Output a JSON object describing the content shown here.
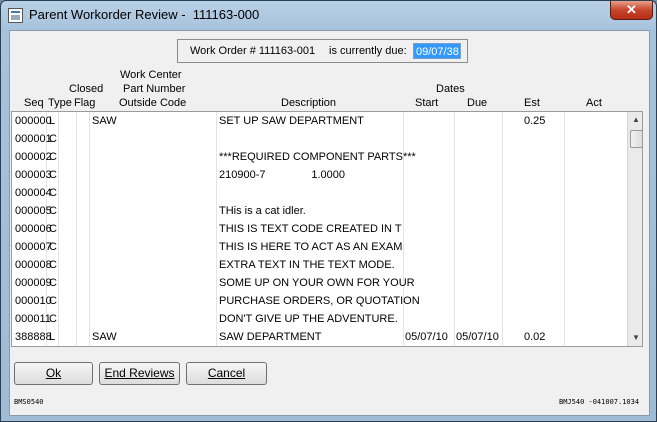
{
  "window": {
    "title": "Parent Workorder Review -  111163-000"
  },
  "workorder": {
    "label": "Work Order # 111163-001",
    "due_label": "is currently due:",
    "due_value": "09/07/38"
  },
  "headers": {
    "seq": "Seq",
    "type": "Type",
    "closed": "Closed",
    "flag": "Flag",
    "work_center": "Work Center",
    "part_number": "Part Number",
    "outside_code": "Outside Code",
    "description": "Description",
    "dates": "Dates",
    "start": "Start",
    "due": "Due",
    "est": "Est",
    "act": "Act"
  },
  "rows": [
    {
      "seq": "000000",
      "type": "L",
      "code": "SAW",
      "description": "SET UP SAW DEPARTMENT",
      "start": "",
      "due": "",
      "est": "0.25"
    },
    {
      "seq": "000001",
      "type": "C",
      "code": "",
      "description": "",
      "start": "",
      "due": "",
      "est": ""
    },
    {
      "seq": "000002",
      "type": "C",
      "code": "",
      "description": "***REQUIRED COMPONENT PARTS***",
      "start": "",
      "due": "",
      "est": ""
    },
    {
      "seq": "000003",
      "type": "C",
      "code": "",
      "description": "210900-7               1.0000",
      "start": "",
      "due": "",
      "est": ""
    },
    {
      "seq": "000004",
      "type": "C",
      "code": "",
      "description": "",
      "start": "",
      "due": "",
      "est": ""
    },
    {
      "seq": "000005",
      "type": "C",
      "code": "",
      "description": "THis is a cat idler.",
      "start": "",
      "due": "",
      "est": ""
    },
    {
      "seq": "000006",
      "type": "C",
      "code": "",
      "description": "THIS IS TEXT CODE CREATED IN T",
      "start": "",
      "due": "",
      "est": ""
    },
    {
      "seq": "000007",
      "type": "C",
      "code": "",
      "description": "THIS IS HERE TO ACT AS AN EXAM",
      "start": "",
      "due": "",
      "est": ""
    },
    {
      "seq": "000008",
      "type": "C",
      "code": "",
      "description": "EXTRA TEXT IN THE TEXT MODE.",
      "start": "",
      "due": "",
      "est": ""
    },
    {
      "seq": "000009",
      "type": "C",
      "code": "",
      "description": "SOME UP ON YOUR OWN FOR YOUR",
      "start": "",
      "due": "",
      "est": ""
    },
    {
      "seq": "000010",
      "type": "C",
      "code": "",
      "description": "PURCHASE ORDERS, OR QUOTATION",
      "start": "",
      "due": "",
      "est": ""
    },
    {
      "seq": "000011",
      "type": "C",
      "code": "",
      "description": "DON'T GIVE UP THE ADVENTURE.",
      "start": "",
      "due": "",
      "est": ""
    },
    {
      "seq": "388888",
      "type": "L",
      "code": "SAW",
      "description": "SAW DEPARTMENT",
      "start": "05/07/10",
      "due": "05/07/10",
      "est": "0.02"
    }
  ],
  "buttons": {
    "ok": "Ok",
    "end_reviews": "End Reviews",
    "cancel": "Cancel"
  },
  "footer": {
    "left": "BMS0540",
    "right": "BMJ540 -041007.1034"
  },
  "icons": {
    "close": "close-icon",
    "app": "app-icon",
    "scroll_up": "chevron-up-icon",
    "scroll_down": "chevron-down-icon"
  }
}
